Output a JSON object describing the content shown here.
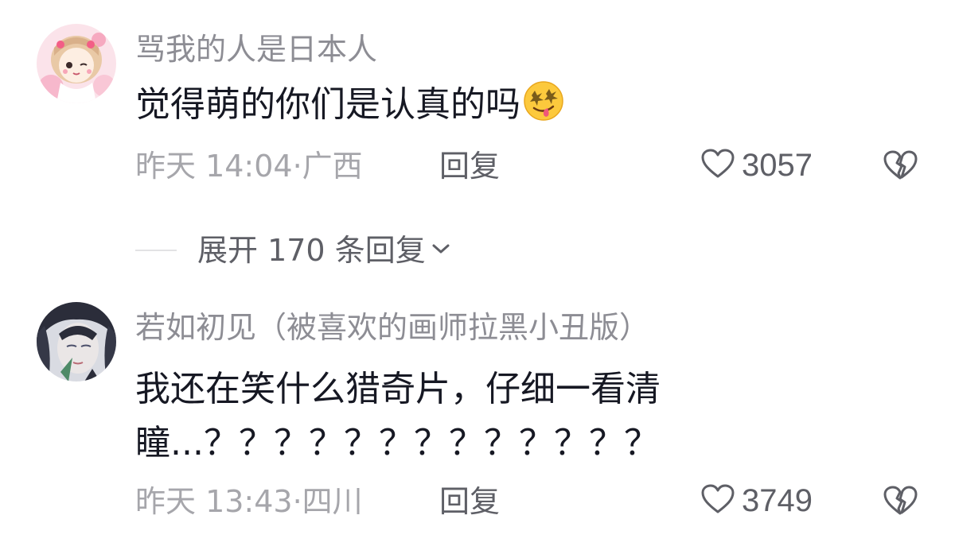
{
  "comments": [
    {
      "username": "骂我的人是日本人",
      "content_text": "觉得萌的你们是认真的吗",
      "emoji": "drooling-face-emoji",
      "time_location": "昨天 14:04·广西",
      "reply_label": "回复",
      "likes": "3057"
    },
    {
      "username": "若如初见（被喜欢的画师拉黑小丑版）",
      "content_line1": "我还在笑什么猎奇片，仔细一看清",
      "content_line2": "瞳...？？？？？？？？？？？？？",
      "time_location": "昨天 13:43·四川",
      "reply_label": "回复",
      "likes": "3749"
    }
  ],
  "expand_replies": {
    "label": "展开 170 条回复"
  },
  "colors": {
    "username": "#8d8d94",
    "content": "#161823",
    "meta": "#a6a6ab",
    "action": "#5e5f66"
  }
}
